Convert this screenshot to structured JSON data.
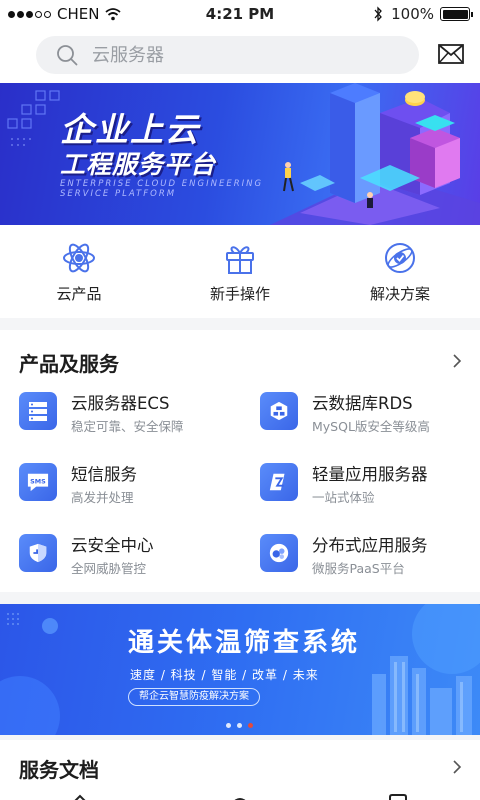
{
  "status_bar": {
    "carrier": "CHEN",
    "time": "4:21 PM",
    "battery": "100%"
  },
  "search": {
    "placeholder": "云服务器"
  },
  "banner": {
    "title_line1": "企业上云",
    "title_line2": "工程服务平台",
    "subtitle_line1": "ENTERPRISE CLOUD ENGINEERING",
    "subtitle_line2": "SERVICE PLATFORM"
  },
  "quick_actions": [
    {
      "label": "云产品",
      "icon": "atom-icon"
    },
    {
      "label": "新手操作",
      "icon": "gift-icon"
    },
    {
      "label": "解决方案",
      "icon": "solution-icon"
    }
  ],
  "products_section": {
    "title": "产品及服务",
    "items": [
      {
        "name": "云服务器ECS",
        "desc": "稳定可靠、安全保障",
        "icon": "server-icon"
      },
      {
        "name": "云数据库RDS",
        "desc": "MySQL版安全等级高",
        "icon": "database-icon"
      },
      {
        "name": "短信服务",
        "desc": "高发并处理",
        "icon": "sms-icon"
      },
      {
        "name": "轻量应用服务器",
        "desc": "一站式体验",
        "icon": "lightweight-server-icon"
      },
      {
        "name": "云安全中心",
        "desc": "全网威胁管控",
        "icon": "shield-icon"
      },
      {
        "name": "分布式应用服务",
        "desc": "微服务PaaS平台",
        "icon": "distributed-icon"
      }
    ]
  },
  "promo_banner": {
    "title": "通关体温筛查系统",
    "tags": "速度 / 科技 / 智能 / 改革 / 未来",
    "cta": "帮企云智慧防疫解决方案",
    "pager_count": 3,
    "pager_active": 3
  },
  "docs_section": {
    "title": "服务文档"
  },
  "colors": {
    "accent": "#3a66e8",
    "pager_active": "#e34a3c",
    "banner_bg": "#2b4de0"
  }
}
